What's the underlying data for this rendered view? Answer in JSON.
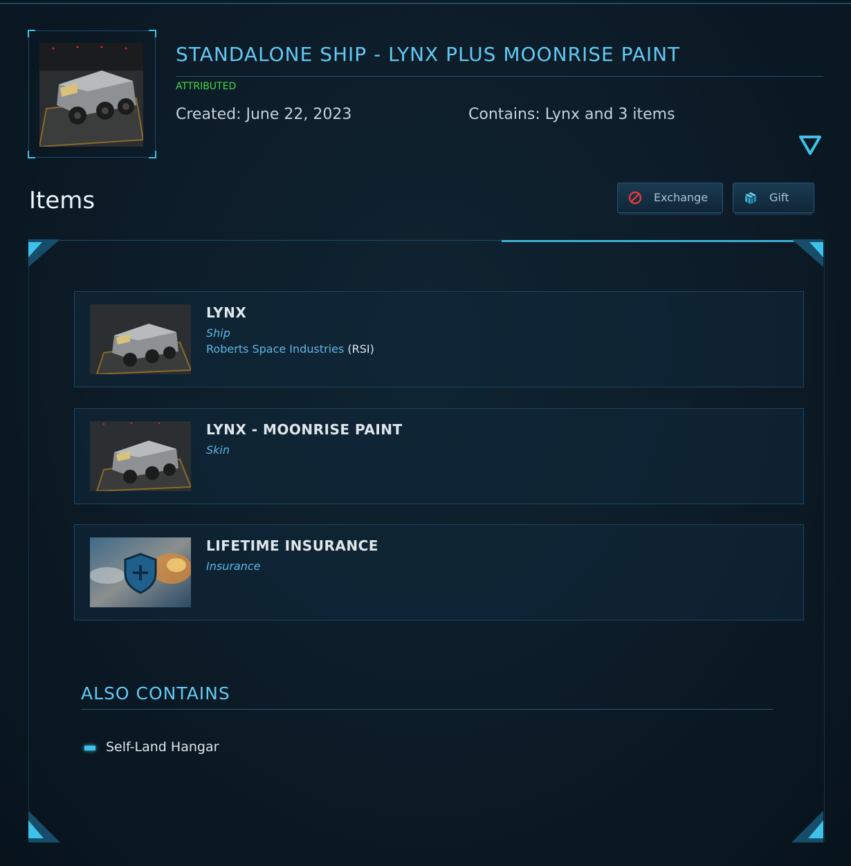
{
  "pledge": {
    "title": "STANDALONE SHIP - LYNX PLUS MOONRISE PAINT",
    "status": "ATTRIBUTED",
    "created": "Created: June 22, 2023",
    "contains": "Contains: Lynx and 3 items",
    "thumbnail_icon": "rover-vehicle-image",
    "toggle_icon": "triangle-down-icon"
  },
  "items_section": {
    "heading": "Items",
    "actions": {
      "exchange_label": "Exchange",
      "exchange_icon": "no-entry-icon",
      "gift_label": "Gift",
      "gift_icon": "gift-box-icon"
    },
    "items": [
      {
        "name": "LYNX",
        "type": "Ship",
        "manufacturer": "Roberts Space Industries",
        "manufacturer_code": "(RSI)",
        "image": "rover-vehicle-image"
      },
      {
        "name": "LYNX - MOONRISE PAINT",
        "type": "Skin",
        "image": "rover-vehicle-image"
      },
      {
        "name": "LIFETIME INSURANCE",
        "type": "Insurance",
        "image": "insurance-shield-image"
      }
    ]
  },
  "also_contains": {
    "heading": "ALSO CONTAINS",
    "items": [
      "Self-Land Hangar"
    ]
  },
  "colors": {
    "accent": "#3fc2e8",
    "title": "#63c9f2",
    "status_green": "#45d845",
    "background": "#0b1a26"
  }
}
